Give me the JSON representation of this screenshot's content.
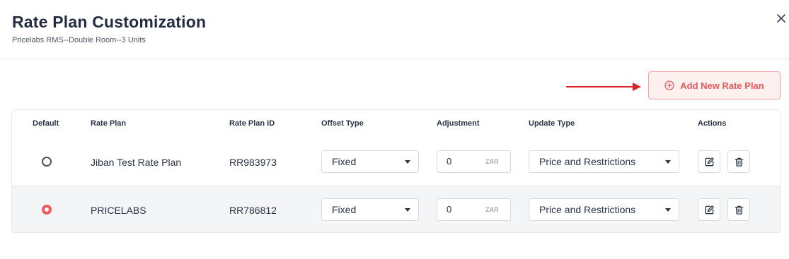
{
  "modal": {
    "title": "Rate Plan Customization",
    "subtitle": "Pricelabs RMS--Double Room--3 Units",
    "close_icon": "close-icon"
  },
  "toolbar": {
    "add_label": "Add New Rate Plan",
    "add_icon": "plus-circle-icon",
    "accent_color": "#e35b5b"
  },
  "table": {
    "headers": [
      "Default",
      "Rate Plan",
      "Rate Plan ID",
      "Offset Type",
      "Adjustment",
      "Update Type",
      "Actions"
    ],
    "rows": [
      {
        "default": false,
        "rate_plan": "Jiban Test Rate Plan",
        "rate_plan_id": "RR983973",
        "offset_type": "Fixed",
        "adjustment": "0",
        "currency": "ZAR",
        "update_type": "Price and Restrictions"
      },
      {
        "default": true,
        "rate_plan": "PRICELABS",
        "rate_plan_id": "RR786812",
        "offset_type": "Fixed",
        "adjustment": "0",
        "currency": "ZAR",
        "update_type": "Price and Restrictions"
      }
    ],
    "action_icons": [
      "edit-icon",
      "trash-icon"
    ]
  }
}
